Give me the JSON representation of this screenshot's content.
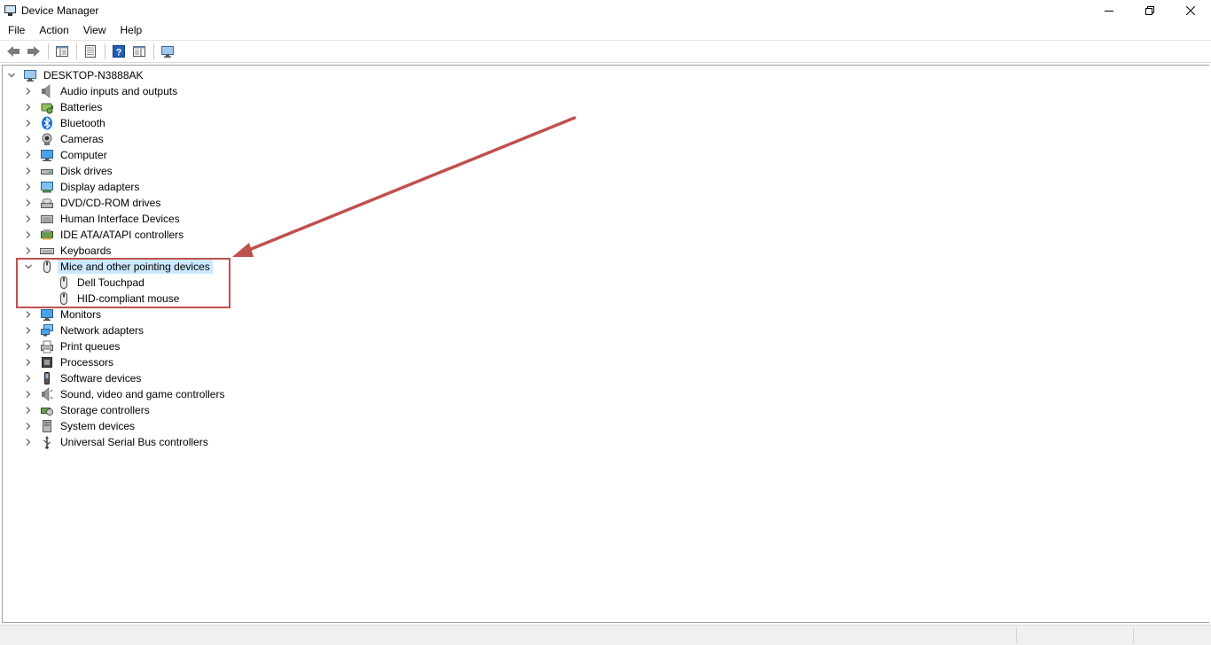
{
  "window": {
    "title": "Device Manager"
  },
  "menubar": {
    "items": [
      "File",
      "Action",
      "View",
      "Help"
    ]
  },
  "toolbar": {
    "buttons": [
      "back-icon",
      "forward-icon",
      "properties-pane-icon",
      "device-list-icon",
      "help-icon",
      "action-pane-icon",
      "scan-hardware-icon"
    ]
  },
  "tree": {
    "root": "DESKTOP-N3888AK",
    "categories": [
      {
        "label": "Audio inputs and outputs",
        "icon": "speaker-icon"
      },
      {
        "label": "Batteries",
        "icon": "battery-icon"
      },
      {
        "label": "Bluetooth",
        "icon": "bluetooth-icon"
      },
      {
        "label": "Cameras",
        "icon": "camera-icon"
      },
      {
        "label": "Computer",
        "icon": "computer-icon"
      },
      {
        "label": "Disk drives",
        "icon": "disk-drive-icon"
      },
      {
        "label": "Display adapters",
        "icon": "display-adapter-icon"
      },
      {
        "label": "DVD/CD-ROM drives",
        "icon": "dvd-drive-icon"
      },
      {
        "label": "Human Interface Devices",
        "icon": "hid-icon"
      },
      {
        "label": "IDE ATA/ATAPI controllers",
        "icon": "ide-controller-icon"
      },
      {
        "label": "Keyboards",
        "icon": "keyboard-icon"
      },
      {
        "label": "Mice and other pointing devices",
        "icon": "mouse-icon",
        "expanded": true,
        "children": [
          {
            "label": "Dell Touchpad",
            "icon": "mouse-icon"
          },
          {
            "label": "HID-compliant mouse",
            "icon": "mouse-icon"
          }
        ]
      },
      {
        "label": "Monitors",
        "icon": "monitor-icon"
      },
      {
        "label": "Network adapters",
        "icon": "network-adapter-icon"
      },
      {
        "label": "Print queues",
        "icon": "printer-icon"
      },
      {
        "label": "Processors",
        "icon": "processor-icon"
      },
      {
        "label": "Software devices",
        "icon": "software-device-icon"
      },
      {
        "label": "Sound, video and game controllers",
        "icon": "sound-controller-icon"
      },
      {
        "label": "Storage controllers",
        "icon": "storage-controller-icon"
      },
      {
        "label": "System devices",
        "icon": "system-device-icon"
      },
      {
        "label": "Universal Serial Bus controllers",
        "icon": "usb-icon"
      }
    ]
  },
  "colors": {
    "annotation": "#c0504d",
    "selection": "#cce8ff"
  }
}
